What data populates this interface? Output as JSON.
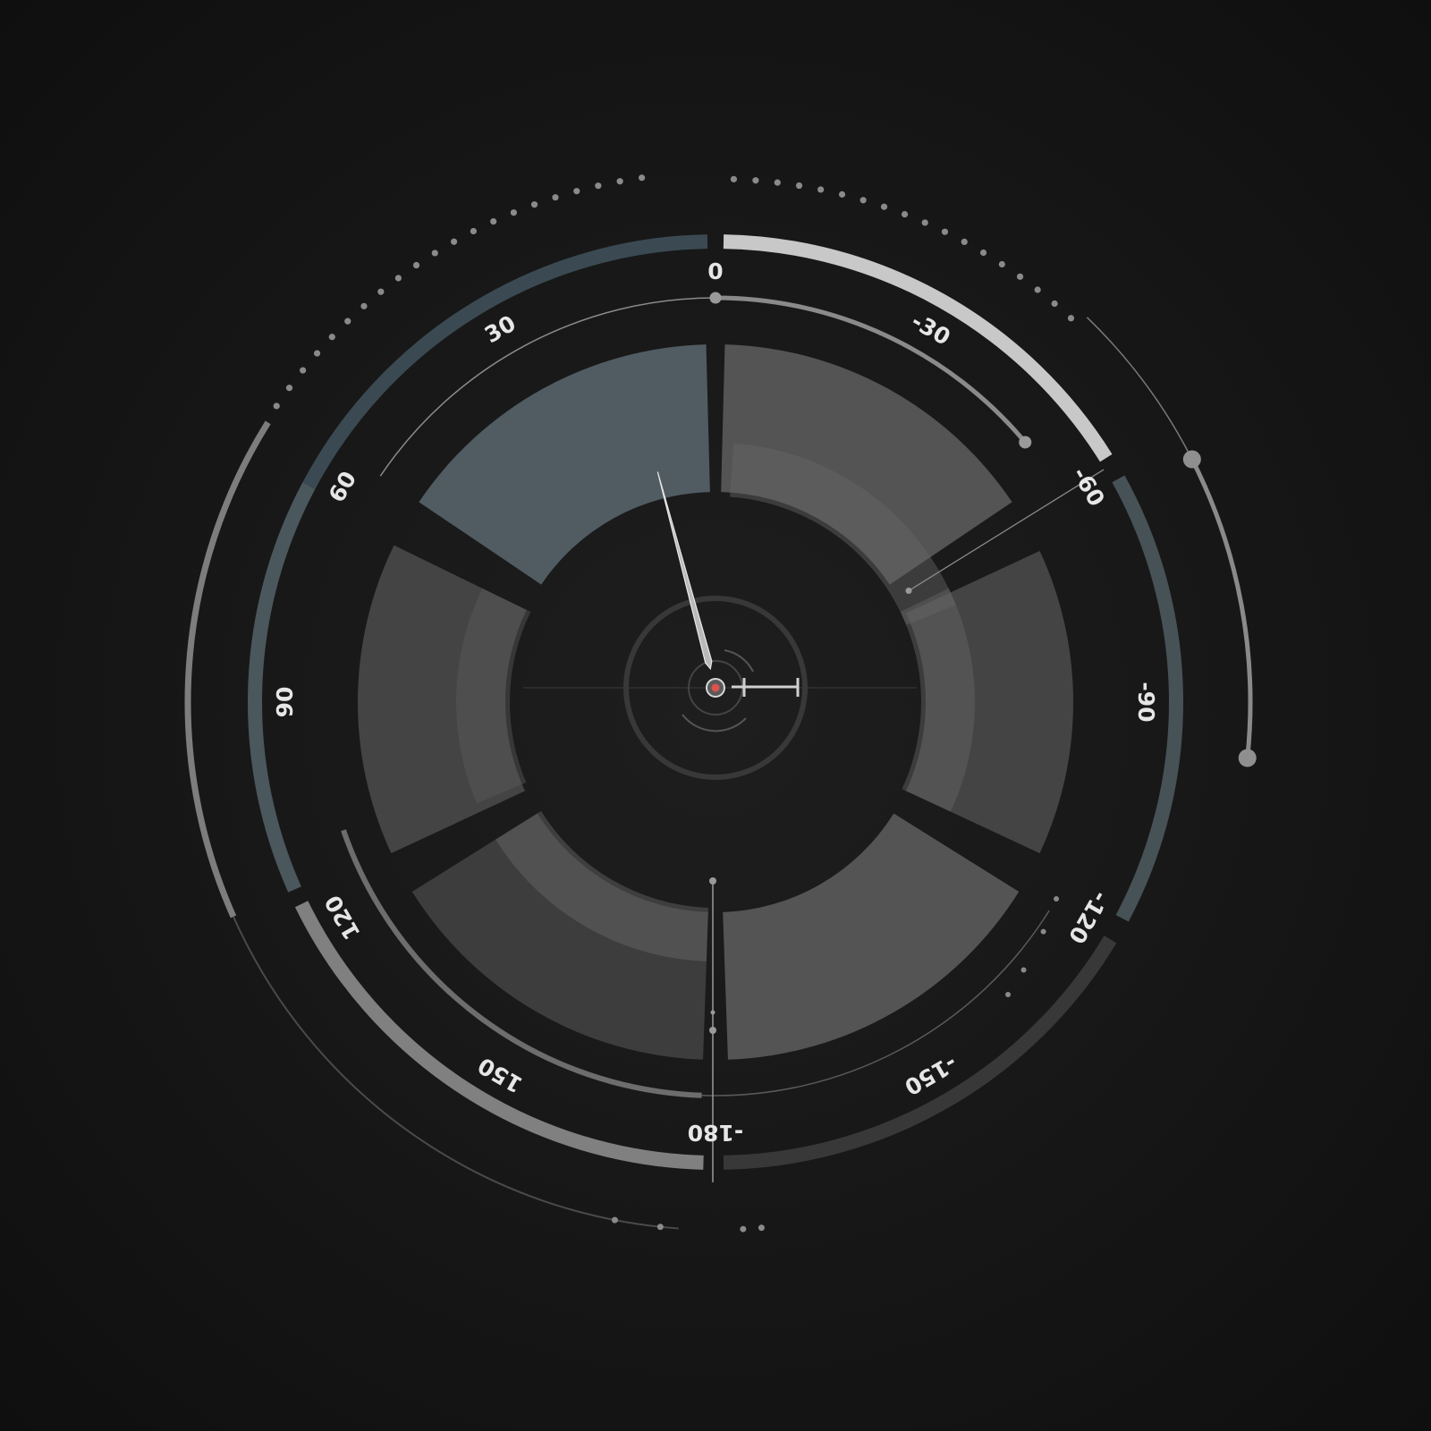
{
  "dial": {
    "labels": [
      {
        "id": "label-0",
        "text": "0",
        "angle": 0
      },
      {
        "id": "label-neg30",
        "text": "-30",
        "angle": -30
      },
      {
        "id": "label-neg60",
        "text": "-60",
        "angle": -60
      },
      {
        "id": "label-neg90",
        "text": "-90",
        "angle": -90
      },
      {
        "id": "label-neg120",
        "text": "-120",
        "angle": -120
      },
      {
        "id": "label-neg150",
        "text": "-150",
        "angle": -150
      },
      {
        "id": "label-neg180",
        "text": "-180",
        "angle": -180
      },
      {
        "id": "label-150",
        "text": "150",
        "angle": 150
      },
      {
        "id": "label-120",
        "text": "120",
        "angle": 120
      },
      {
        "id": "label-90",
        "text": "90",
        "angle": 90
      },
      {
        "id": "label-60",
        "text": "60",
        "angle": 60
      },
      {
        "id": "label-30",
        "text": "30",
        "angle": 30
      }
    ],
    "needle_angle": 15,
    "colors": {
      "background": "#141414",
      "slate": "#3b4a52",
      "light": "#c8c8c8",
      "mid": "#808080",
      "dark": "#3a3a3a",
      "accent": "#d9534f"
    }
  }
}
